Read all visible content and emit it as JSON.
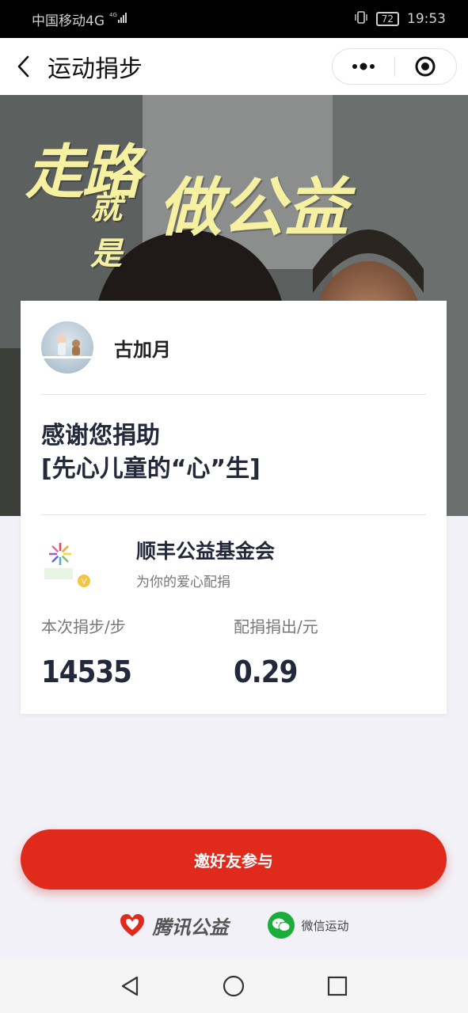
{
  "status_bar": {
    "carrier": "中国移动4G",
    "battery": "72",
    "time": "19:53"
  },
  "title_bar": {
    "title": "运动捐步"
  },
  "hero": {
    "line1": "走路",
    "line2": "就是",
    "line3": "做公益"
  },
  "card": {
    "user_name": "古加月",
    "thanks_line1": "感谢您捐助",
    "thanks_line2": "[先心儿童的“心”生]",
    "org_name": "顺丰公益基金会",
    "org_desc": "为你的爱心配捐",
    "steps_label": "本次捐步/步",
    "steps_value": "14535",
    "match_label": "配捐捐出/元",
    "match_value": "0.29"
  },
  "invite_button": "邀好友参与",
  "footer": {
    "brand1": "腾讯公益",
    "brand2": "微信运动"
  },
  "colors": {
    "accent_red": "#e02a1c",
    "banner_yellow": "#f6f1a0",
    "wechat_green": "#1aad3a"
  }
}
